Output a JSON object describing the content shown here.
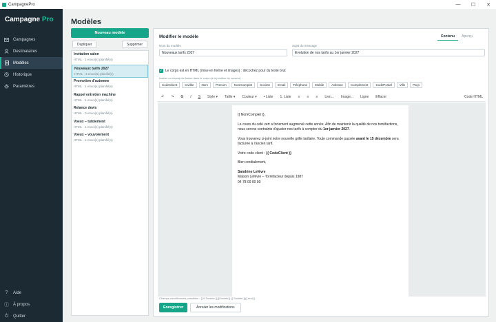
{
  "window": {
    "title": "CampagnePro",
    "minimize": "—",
    "maximize": "☐",
    "close": "✕"
  },
  "sidebar": {
    "brand_main": "Campagne",
    "brand_accent": "Pro",
    "items": [
      {
        "label": "Campagnes",
        "icon": "mail-icon"
      },
      {
        "label": "Destinataires",
        "icon": "users-icon"
      },
      {
        "label": "Modèles",
        "icon": "template-icon"
      },
      {
        "label": "Historique",
        "icon": "history-icon"
      },
      {
        "label": "Paramètres",
        "icon": "gear-icon"
      }
    ],
    "bottom_items": [
      {
        "label": "Aide",
        "icon": "help-icon"
      },
      {
        "label": "À propos",
        "icon": "info-icon"
      },
      {
        "label": "Quitter",
        "icon": "power-icon"
      }
    ]
  },
  "page": {
    "title": "Modèles"
  },
  "templates_panel": {
    "new_button": "Nouveau modèle",
    "duplicate_button": "Dupliquer",
    "delete_button": "Supprimer",
    "items": [
      {
        "name": "Invitation salon",
        "meta": "HTML · 1 envoi(s) planifié(s)"
      },
      {
        "name": "Nouveaux tarifs 2027",
        "meta": "HTML · 2 envoi(s) planifié(s)"
      },
      {
        "name": "Promotion d'automne",
        "meta": "HTML · 1 envoi(s) planifié(s)"
      },
      {
        "name": "Rappel entretien machine",
        "meta": "HTML · 1 envoi(s) planifié(s)"
      },
      {
        "name": "Relance devis",
        "meta": "HTML · 0 envoi(s) planifié(s)"
      },
      {
        "name": "Voeux – tutoiement",
        "meta": "HTML · 1 envoi(s) planifié(s)"
      },
      {
        "name": "Voeux – vouvoiement",
        "meta": "HTML · 1 envoi(s) planifié(s)"
      }
    ]
  },
  "editor": {
    "title": "Modifier le modèle",
    "tabs": [
      "Contenu",
      "Aperçu"
    ],
    "name_label": "Nom du modèle",
    "name_value": "Nouveaux tarifs 2027",
    "subject_label": "Sujet du message",
    "subject_value": "Evolution de nos tarifs au 1er janvier 2027",
    "html_checkbox": "Le corps est en HTML (mise en forme et images) : décochez pour du texte brut",
    "merge_hint": "Insérer un champ de fusion dans le corps (à la position du curseur) :",
    "merge_fields": [
      "CodeClient",
      "Civilite",
      "Nom",
      "Prenom",
      "NomComplet",
      "Societe",
      "Email",
      "Telephone",
      "Mobile",
      "Adresse",
      "Complement",
      "CodePostal",
      "Ville",
      "Pays"
    ],
    "toolbar": {
      "undo": "↶",
      "redo": "↷",
      "bold": "G",
      "italic": "I",
      "underline": "S",
      "style": "Style ▾",
      "size": "Taille ▾",
      "color": "Couleur ▾",
      "bullets": "• Liste",
      "numbers": "1. Liste",
      "align_left": "≡",
      "align_center": "≡",
      "align_right": "≡",
      "link": "Lien...",
      "image": "Image...",
      "line": "Ligne",
      "clear": "Effacer",
      "html_code": "Code HTML"
    },
    "body": {
      "greeting": "{{ NomComplet }},",
      "p1_a": "Le cours du café vert a fortement augmenté cette année. Afin de maintenir la qualité de nos torréfactions, nous serons contraints d'ajuster nos tarifs à compter du ",
      "p1_b": "1er janvier 2027",
      "p1_c": ".",
      "p2_a": "Vous trouverez ci-joint notre nouvelle grille tarifaire. Toute commande passée ",
      "p2_b": "avant le 15 décembre",
      "p2_c": " sera facturée à l'ancien tarif.",
      "p3_a": "Votre code client : ",
      "p3_b": "{{ CodeClient }}",
      "closing": "Bien cordialement,",
      "sig_name": "Sandrine Lefèvre",
      "sig_company": "Maison Lefèvre – Torréfacteur depuis 1987",
      "sig_phone": "04 78 00 00 00"
    },
    "conditional_hint": "Champs conditionnels possibles : {{ if Societe }}{{Societe}} {{ Societe }}{{ end }}",
    "save_button": "Enregistrer",
    "cancel_button": "Annuler les modifications"
  }
}
